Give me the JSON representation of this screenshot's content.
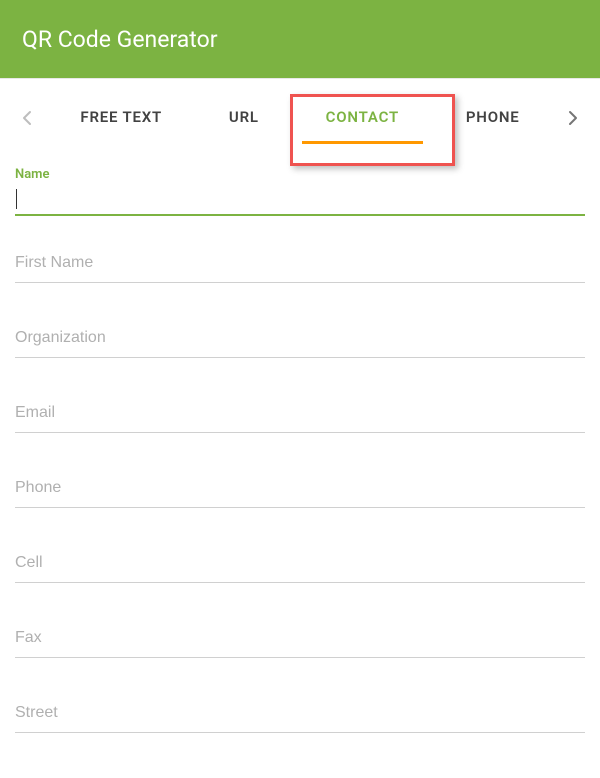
{
  "header": {
    "title": "QR Code Generator"
  },
  "tabs": {
    "items": [
      {
        "label": "FREE TEXT"
      },
      {
        "label": "URL"
      },
      {
        "label": "CONTACT"
      },
      {
        "label": "PHONE"
      }
    ],
    "activeIndex": 2
  },
  "form": {
    "name": {
      "label": "Name",
      "value": ""
    },
    "fields": [
      {
        "placeholder": "First Name"
      },
      {
        "placeholder": "Organization"
      },
      {
        "placeholder": "Email"
      },
      {
        "placeholder": "Phone"
      },
      {
        "placeholder": "Cell"
      },
      {
        "placeholder": "Fax"
      },
      {
        "placeholder": "Street"
      }
    ]
  }
}
